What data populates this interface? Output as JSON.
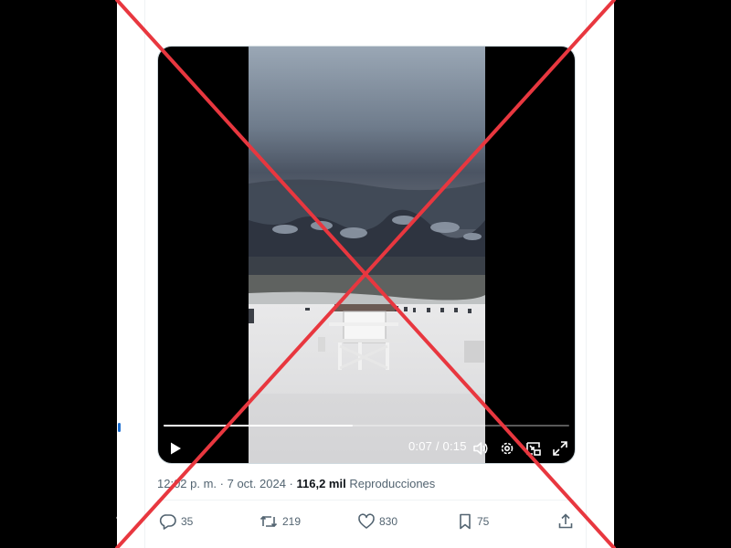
{
  "video": {
    "time_display": "0:07 / 0:15",
    "progress": 0.4667,
    "play_icon": "play-icon",
    "volume_icon": "volume-icon",
    "settings_icon": "gear-icon",
    "pip_icon": "picture-in-picture-icon",
    "fullscreen_icon": "fullscreen-icon"
  },
  "meta": {
    "time": "12:02 p. m.",
    "separator": " · ",
    "date": "7 oct. 2024",
    "views_count": "116,2 mil",
    "views_label": " Reproducciones"
  },
  "actions": {
    "replies": "35",
    "reposts": "219",
    "likes": "830",
    "bookmarks": "75"
  },
  "overlay": {
    "color": "#e8373f"
  },
  "colors": {
    "muted": "#536471",
    "text": "#0f1419"
  }
}
